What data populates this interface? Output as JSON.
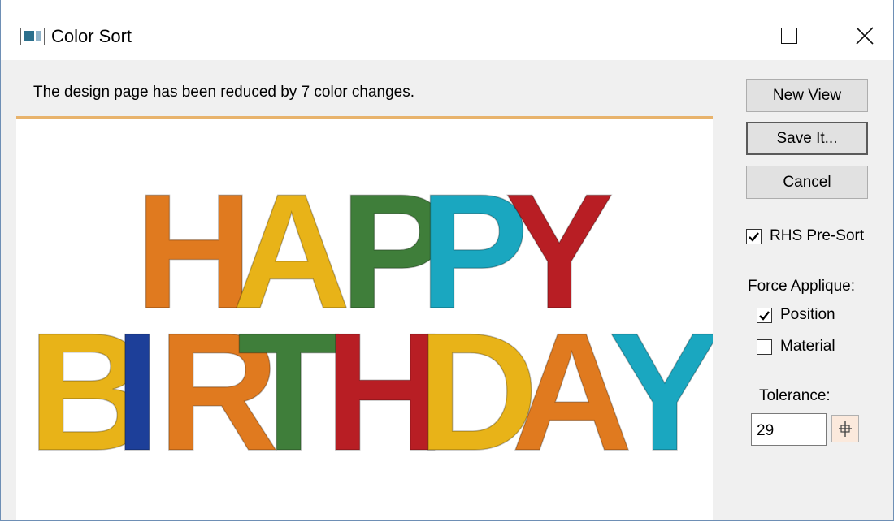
{
  "window": {
    "title": "Color Sort",
    "icons": {
      "app": "color-sort-app-icon",
      "minimize": "minimize-icon",
      "maximize": "maximize-icon",
      "close": "close-icon"
    }
  },
  "message": "The design page has been reduced by 7 color changes.",
  "preview": {
    "line1": [
      {
        "char": "H",
        "color": "#e07a1f"
      },
      {
        "char": "A",
        "color": "#e8b318"
      },
      {
        "char": "P",
        "color": "#3f7e3a"
      },
      {
        "char": "P",
        "color": "#1aa7c0"
      },
      {
        "char": "Y",
        "color": "#b81e24"
      }
    ],
    "line2": [
      {
        "char": "B",
        "color": "#e8b318"
      },
      {
        "char": "I",
        "color": "#1d3f99"
      },
      {
        "char": "R",
        "color": "#e07a1f"
      },
      {
        "char": "T",
        "color": "#3f7e3a"
      },
      {
        "char": "H",
        "color": "#b81e24"
      },
      {
        "char": "D",
        "color": "#e8b318"
      },
      {
        "char": "A",
        "color": "#e07a1f"
      },
      {
        "char": "Y",
        "color": "#1aa7c0"
      }
    ]
  },
  "buttons": {
    "new_view": "New View",
    "save_it": "Save It...",
    "cancel": "Cancel"
  },
  "options": {
    "rhs_presort": {
      "label": "RHS Pre-Sort",
      "checked": true
    },
    "force_applique": {
      "label": "Force Applique:",
      "position": {
        "label": "Position",
        "checked": true
      },
      "material": {
        "label": "Material",
        "checked": false
      }
    },
    "tolerance": {
      "label": "Tolerance:",
      "value": "29",
      "spin_icon": "spin-arrows-icon"
    }
  },
  "colors": {
    "accent_line": "#e8b36c",
    "window_border": "#6e8fb5"
  }
}
